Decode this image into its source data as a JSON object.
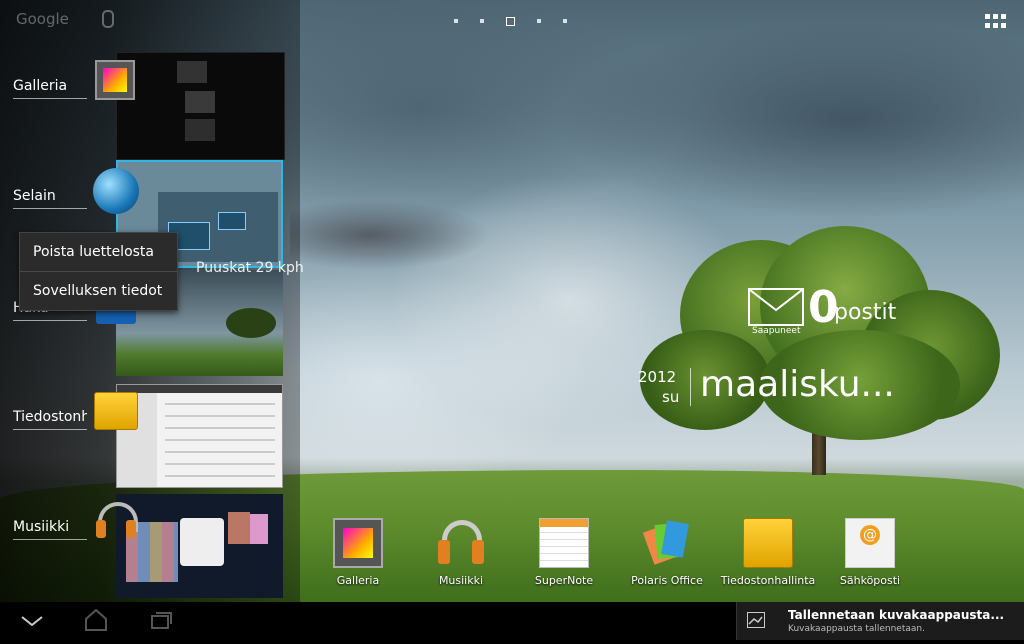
{
  "top": {
    "search_hint": "Google",
    "page_count": 5,
    "active_page_index": 2
  },
  "recent_apps": [
    {
      "label": "Galleria",
      "icon": "gallery-icon"
    },
    {
      "label": "Selain",
      "icon": "browser-globe-icon"
    },
    {
      "label": "Haku",
      "icon": "search-app-icon"
    },
    {
      "label": "Tiedostonhallinta",
      "icon": "folder-icon"
    },
    {
      "label": "Musiikki",
      "icon": "headphones-icon"
    }
  ],
  "context_menu": {
    "items": [
      "Poista luettelosta",
      "Sovelluksen tiedot"
    ]
  },
  "weather_fragment": "Puuskat 29 kph",
  "email_widget": {
    "count": "0",
    "unit": "postit",
    "label": "Saapuneet"
  },
  "calendar_widget": {
    "year": "2012",
    "weekday": "su",
    "month": "maalisku..."
  },
  "dock": [
    {
      "label": "Galleria",
      "icon": "gallery-icon"
    },
    {
      "label": "Musiikki",
      "icon": "headphones-icon"
    },
    {
      "label": "SuperNote",
      "icon": "notepad-icon"
    },
    {
      "label": "Polaris Office",
      "icon": "polaris-office-icon"
    },
    {
      "label": "Tiedostonhallinta",
      "icon": "folder-icon"
    },
    {
      "label": "Sähköposti",
      "icon": "email-icon"
    }
  ],
  "navbar": {
    "buttons": [
      "back-icon",
      "home-icon",
      "recent-apps-icon"
    ]
  },
  "notification": {
    "title": "Tallennetaan kuvakaappausta...",
    "subtitle": "Kuvakaappausta tallennetaan."
  }
}
